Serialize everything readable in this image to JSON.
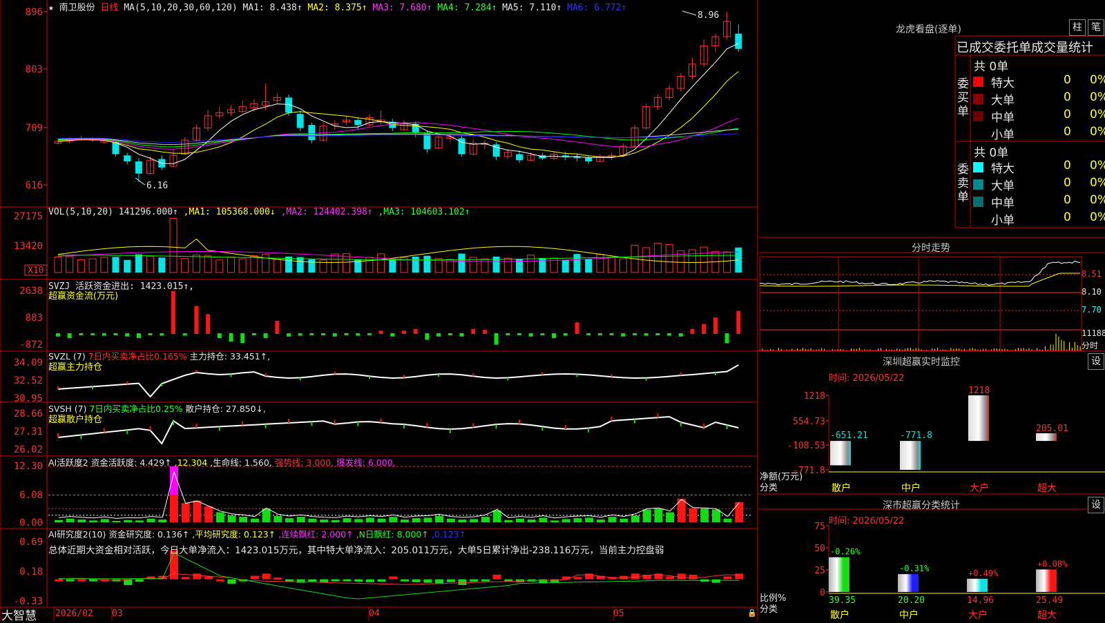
{
  "colors": {
    "up": "#ff3232",
    "down": "#00e5e5",
    "bg": "#000000",
    "frame": "#c80000",
    "text": "#c8c8c8",
    "ma1": "#ffffff",
    "ma2": "#ffff00",
    "ma3": "#ff00ff",
    "ma4": "#00ff00",
    "ma5": "#c8c8c8",
    "ma6": "#2222ff"
  },
  "header": {
    "star": "★",
    "stock_name": "南卫股份",
    "period": "日线",
    "ma_params": "MA(5,10,20,30,60,120)",
    "ma1": "MA1: 8.438↑",
    "ma2": "MA2: 8.375↑",
    "ma3": "MA3: 7.680↑",
    "ma4": "MA4: 7.284↑",
    "ma5": "MA5: 7.110↑",
    "ma6": "MA6: 6.772↑"
  },
  "price_axis": [
    "896",
    "803",
    "709",
    "616"
  ],
  "price_hi": "8.96",
  "price_lo": "6.16",
  "vol": {
    "label": "VOL(5,10,20)",
    "value": "141296.000↑",
    "ma1": ",MA1: 105368.000↓",
    "ma2": ",MA2: 124402.398↑",
    "ma3": ",MA3: 104603.102↑",
    "axis": [
      "27175",
      "13420"
    ],
    "unit": "X10"
  },
  "svzj": {
    "label": "SVZJ  活跃资金进出: 1423.015↑,",
    "sub": "超赢资金流(万元)",
    "axis": [
      "2638",
      "883",
      "-872"
    ]
  },
  "svzl": {
    "label": "SVZL (7)",
    "ratio": "7日内买卖净占比0.165%",
    "hold": "主力持仓: 33.451↑,",
    "sub": "超赢主力持仓",
    "axis": [
      "34.09",
      "32.52",
      "30.95"
    ]
  },
  "svsh": {
    "label": "SVSH (7)",
    "ratio": "7日内买卖净占比0.25%",
    "hold": "散户持仓: 27.850↓,",
    "sub": "超赢散户持仓",
    "axis": [
      "28.66",
      "27.31",
      "26.02"
    ]
  },
  "ai1": {
    "label": "AI活跃度2",
    "act": "资金活跃度: 4.429↑",
    "v2": ",12.304",
    "life": ",生命线: 1.560,",
    "strong": "强势线: 3.000,",
    "burst": "爆发线: 6.000,",
    "axis": [
      "12.30",
      "6.08",
      "0.00"
    ]
  },
  "ai2": {
    "label": "AI研究度2(10)",
    "res": "资金研究度: 0.136↑",
    "avg": ",平均研究度: 0.123↑",
    "cont": ",连续飘红: 2.000↑",
    "nday": ",N日飘红: 8.000↑",
    "last": ",0.123↑",
    "summary": "总体近期大资金相对活跃，今日大单净流入：1423.015万元，其中特大单净流入：205.011万元，大单5日累计净出-238.116万元，当前主力控盘弱",
    "axis": [
      "0.69",
      "0.18",
      "-0.33"
    ]
  },
  "xaxis": [
    "2026/02",
    "03",
    "04",
    "05"
  ],
  "logo": "大智慧",
  "longhu": {
    "title": "龙虎看盘(逐单)",
    "btn1": "柱",
    "btn2": "笔",
    "heading": "已成交委托单成交量统计",
    "buy_side": "委买单",
    "sell_side": "委卖单",
    "buy_total": "共 0单",
    "sell_total": "共 0单",
    "buy_rows": [
      {
        "name": "特大",
        "count": "0",
        "pct": "0%",
        "color": "#ff0000"
      },
      {
        "name": "大单",
        "count": "0",
        "pct": "0%",
        "color": "#8c0000"
      },
      {
        "name": "中单",
        "count": "0",
        "pct": "0%",
        "color": "#6e0000"
      },
      {
        "name": "小单",
        "count": "0",
        "pct": "0%",
        "color": ""
      }
    ],
    "sell_rows": [
      {
        "name": "特大",
        "count": "0",
        "pct": "0%",
        "color": "#00ffff"
      },
      {
        "name": "大单",
        "count": "0",
        "pct": "0%",
        "color": "#008c8c"
      },
      {
        "name": "中单",
        "count": "0",
        "pct": "0%",
        "color": "#007070"
      },
      {
        "name": "小单",
        "count": "0",
        "pct": "0%",
        "color": ""
      }
    ]
  },
  "minute": {
    "title": "分时走势",
    "axis": [
      "8.51",
      "8.10",
      "7.70",
      "11188"
    ],
    "foot": "分时"
  },
  "sz_monitor": {
    "title": "深圳超赢实时监控",
    "btn": "设",
    "time": "时间: 2026/05/22",
    "axis": [
      "1218",
      "554.73",
      "-108.53",
      "-771.8"
    ],
    "ylabel": "净额(万元)",
    "xlabel": "分类",
    "cats": [
      "散户",
      "中户",
      "大户",
      "超大"
    ],
    "values": [
      -651.21,
      -771.8,
      1218,
      205.01
    ],
    "value_labels": [
      "-651.21",
      "-771.8",
      "1218",
      "205.01"
    ]
  },
  "sz_class": {
    "title": "深市超赢分类统计",
    "btn": "设",
    "time": "时间: 2026/05/22",
    "axis": [
      "75",
      "50",
      "25",
      "0"
    ],
    "ylabel": "比例%",
    "xlabel": "分类",
    "cats": [
      "散户",
      "中户",
      "大户",
      "超大"
    ],
    "values": [
      39.35,
      20.2,
      14.96,
      25.49
    ],
    "value_labels": [
      "39.35",
      "20.20",
      "14.96",
      "25.49"
    ],
    "change_labels": [
      "-0.26%",
      "-0.31%",
      "+0.49%",
      "+0.08%"
    ]
  }
}
